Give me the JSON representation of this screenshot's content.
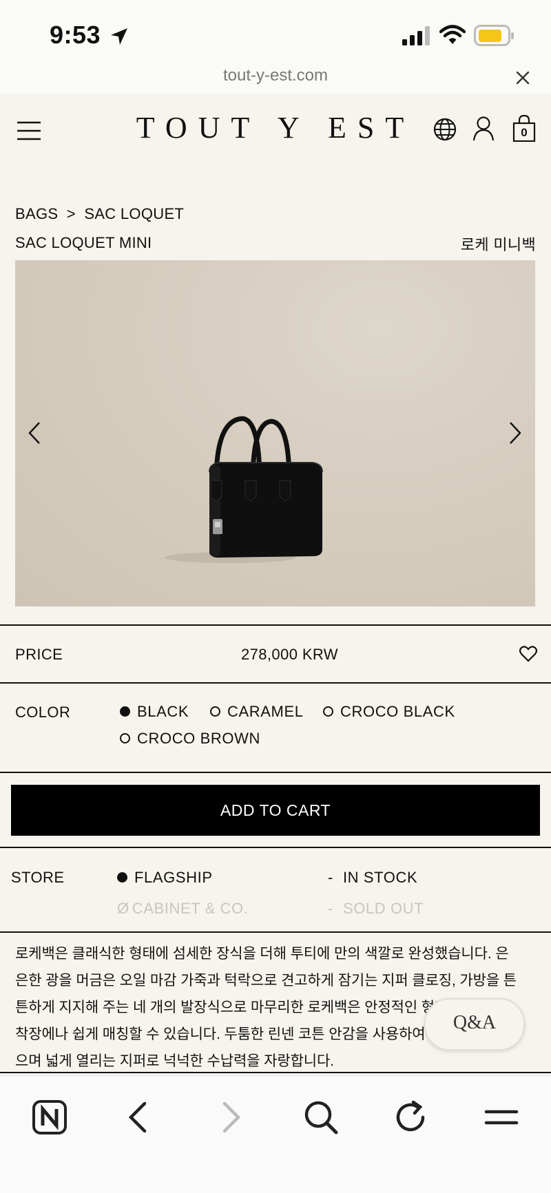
{
  "status_bar": {
    "time": "9:53",
    "icons": [
      "location-arrow-icon",
      "cellular-signal-icon",
      "wifi-icon",
      "battery-icon"
    ],
    "battery_color": "#f5c518"
  },
  "browser": {
    "url": "tout-y-est.com",
    "toolbar_icons": [
      "naver-app-icon",
      "back-icon",
      "forward-icon",
      "search-icon",
      "reload-icon",
      "menu-icon"
    ]
  },
  "header": {
    "logo": "TOUT Y EST",
    "cart_count": "0",
    "icons": [
      "hamburger-menu-icon",
      "globe-icon",
      "account-icon",
      "cart-bag-icon"
    ]
  },
  "breadcrumb": {
    "category": "BAGS",
    "separator": ">",
    "collection": "SAC LOQUET"
  },
  "product": {
    "name": "SAC LOQUET MINI",
    "name_ko": "로케 미니백",
    "image_alt": "Black leather handbag",
    "price_label": "PRICE",
    "price": "278,000 KRW",
    "color_label": "COLOR",
    "colors": [
      {
        "name": "BLACK",
        "selected": true
      },
      {
        "name": "CARAMEL",
        "selected": false
      },
      {
        "name": "CROCO BLACK",
        "selected": false
      },
      {
        "name": "CROCO BROWN",
        "selected": false
      }
    ],
    "add_to_cart": "ADD TO CART",
    "store_label": "STORE",
    "stores": [
      {
        "name": "FLAGSHIP",
        "status": "IN STOCK",
        "available": true
      },
      {
        "name": "CABINET & CO.",
        "status": "SOLD OUT",
        "available": false
      }
    ],
    "description_lines": [
      "로케백은 클래식한 형태에 섬세한 장식을 더해 투티에 만의 색깔로 완성했습니다. 은",
      "은한 광을 머금은 오일 마감 가죽과 턱락으로 견고하게 잠기는 지퍼 클로징, 가방을 튼",
      "튼하게 지지해 주는 네 개의 발장식으로 마무리한 로케백은 안정적인 형태로 어느",
      "착장에나 쉽게 매칭할 수 있습니다. 두툼한 린넨 코튼 안감을 사용하여 내구성을 높였",
      "으며 넓게 열리는 지퍼로 넉넉한 수납력을 자랑합니다."
    ]
  },
  "qa_button": "Q&A",
  "colors": {
    "page_background": "#f6f4ec",
    "button_background": "#000000",
    "muted_text": "#c9c6bd"
  }
}
